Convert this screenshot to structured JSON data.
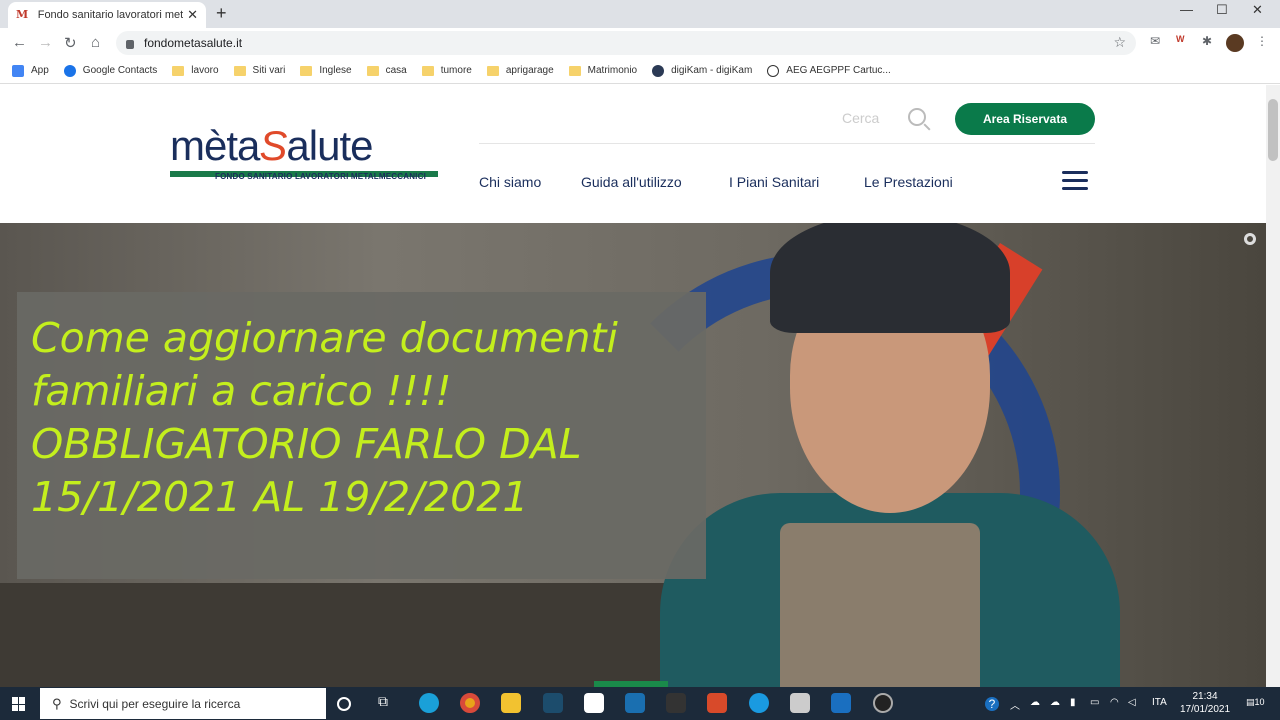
{
  "browser": {
    "tab_title": "Fondo sanitario lavoratori metalmeccanici",
    "tab_favicon": "mètaSalute",
    "url": "fondometasalute.it",
    "bookmarks": [
      "App",
      "Google Contacts",
      "lavoro",
      "Siti vari",
      "Inglese",
      "casa",
      "tumore",
      "aprigarage",
      "Matrimonio",
      "digiKam - digiKam",
      "AEG AEGPPF Cartuc..."
    ]
  },
  "site": {
    "logo_main_a": "mèta",
    "logo_main_s": "S",
    "logo_main_b": "alute",
    "logo_sub": "FONDO SANITARIO LAVORATORI METALMECCANICI",
    "search_label": "Cerca",
    "area_button": "Area Riservata",
    "nav": [
      "Chi siamo",
      "Guida all'utilizzo",
      "I Piani Sanitari",
      "Le Prestazioni"
    ]
  },
  "hero": {
    "overlay_lines": [
      "Come aggiornare documenti",
      "familiari a carico !!!!",
      "OBBLIGATORIO FARLO DAL",
      "15/1/2021 AL 19/2/2021"
    ]
  },
  "taskbar": {
    "search_placeholder": "Scrivi qui per eseguire la ricerca",
    "language": "ITA",
    "time": "21:34",
    "date": "17/01/2021",
    "notifications": "10"
  },
  "colors": {
    "brand_navy": "#1a2e5c",
    "brand_green": "#0a7a4a",
    "brand_red": "#e04a2a",
    "overlay_text": "#c4ef1d"
  }
}
